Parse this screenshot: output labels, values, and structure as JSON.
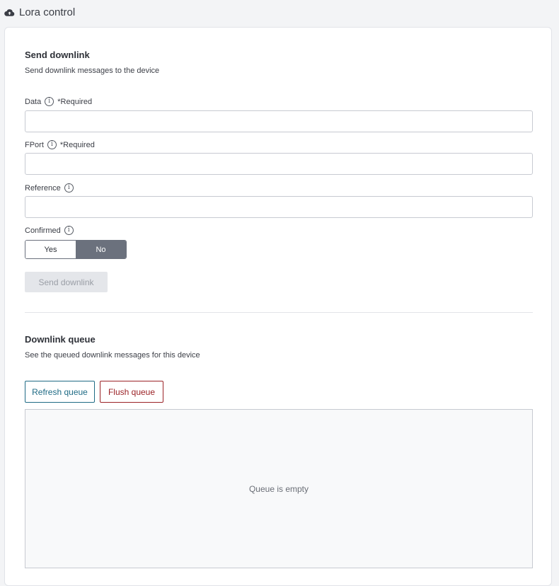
{
  "header": {
    "title": "Lora control",
    "icon": "cloud-upload-icon"
  },
  "send_section": {
    "title": "Send downlink",
    "subtitle": "Send downlink messages to the device",
    "fields": {
      "data": {
        "label": "Data",
        "required": "*Required",
        "value": "",
        "placeholder": ""
      },
      "fport": {
        "label": "FPort",
        "required": "*Required",
        "value": "",
        "placeholder": ""
      },
      "reference": {
        "label": "Reference",
        "value": "",
        "placeholder": ""
      }
    },
    "confirmed": {
      "label": "Confirmed",
      "yes": "Yes",
      "no": "No",
      "selected": "No"
    },
    "send_button": "Send downlink"
  },
  "queue_section": {
    "title": "Downlink queue",
    "subtitle": "See the queued downlink messages for this device",
    "refresh_button": "Refresh queue",
    "flush_button": "Flush queue",
    "empty_text": "Queue is empty"
  },
  "colors": {
    "primary_outline": "#1f6b85",
    "danger_outline": "#9b2226",
    "toggle_selected": "#6b717d",
    "disabled_bg": "#e4e6ea"
  }
}
